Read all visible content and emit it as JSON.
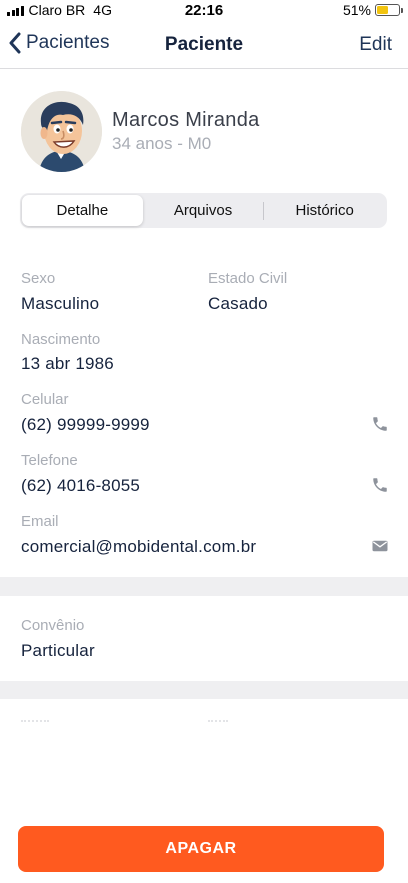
{
  "status_bar": {
    "carrier": "Claro BR",
    "network": "4G",
    "time": "22:16",
    "battery_percent": "51%",
    "battery_level": 0.51
  },
  "nav": {
    "back_label": "Pacientes",
    "title": "Paciente",
    "edit_label": "Edit"
  },
  "patient": {
    "name": "Marcos Miranda",
    "subtitle": "34 anos - M0"
  },
  "tabs": [
    {
      "label": "Detalhe",
      "active": true
    },
    {
      "label": "Arquivos",
      "active": false
    },
    {
      "label": "Histórico",
      "active": false
    }
  ],
  "details": {
    "sexo_label": "Sexo",
    "sexo_value": "Masculino",
    "estado_civil_label": "Estado Civil",
    "estado_civil_value": "Casado",
    "nascimento_label": "Nascimento",
    "nascimento_value": "13 abr 1986",
    "celular_label": "Celular",
    "celular_value": "(62) 99999-9999",
    "telefone_label": "Telefone",
    "telefone_value": "(62) 4016-8055",
    "email_label": "Email",
    "email_value": "comercial@mobidental.com.br"
  },
  "convenio": {
    "label": "Convênio",
    "value": "Particular"
  },
  "actions": {
    "delete_label": "APAGAR"
  },
  "colors": {
    "accent": "#ff5a1f",
    "navy": "#16233d",
    "label_gray": "#a9adb5",
    "section_bg": "#efeff1"
  },
  "icons": {
    "back": "chevron-left-icon",
    "phone": "phone-icon",
    "mail": "mail-icon"
  }
}
